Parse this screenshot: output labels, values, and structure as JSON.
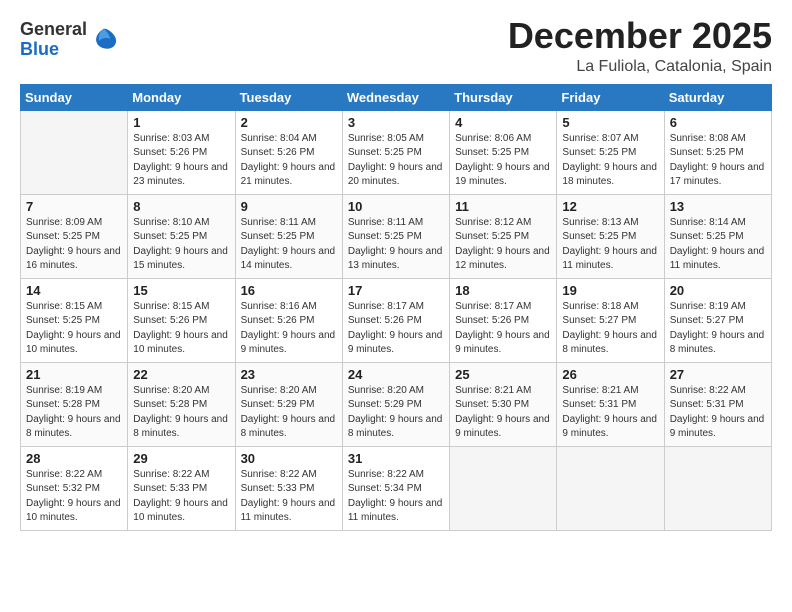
{
  "header": {
    "logo_general": "General",
    "logo_blue": "Blue",
    "month_title": "December 2025",
    "location": "La Fuliola, Catalonia, Spain"
  },
  "weekdays": [
    "Sunday",
    "Monday",
    "Tuesday",
    "Wednesday",
    "Thursday",
    "Friday",
    "Saturday"
  ],
  "weeks": [
    [
      {
        "num": "",
        "empty": true
      },
      {
        "num": "1",
        "sunrise": "8:03 AM",
        "sunset": "5:26 PM",
        "daylight": "9 hours and 23 minutes."
      },
      {
        "num": "2",
        "sunrise": "8:04 AM",
        "sunset": "5:26 PM",
        "daylight": "9 hours and 21 minutes."
      },
      {
        "num": "3",
        "sunrise": "8:05 AM",
        "sunset": "5:25 PM",
        "daylight": "9 hours and 20 minutes."
      },
      {
        "num": "4",
        "sunrise": "8:06 AM",
        "sunset": "5:25 PM",
        "daylight": "9 hours and 19 minutes."
      },
      {
        "num": "5",
        "sunrise": "8:07 AM",
        "sunset": "5:25 PM",
        "daylight": "9 hours and 18 minutes."
      },
      {
        "num": "6",
        "sunrise": "8:08 AM",
        "sunset": "5:25 PM",
        "daylight": "9 hours and 17 minutes."
      }
    ],
    [
      {
        "num": "7",
        "sunrise": "8:09 AM",
        "sunset": "5:25 PM",
        "daylight": "9 hours and 16 minutes."
      },
      {
        "num": "8",
        "sunrise": "8:10 AM",
        "sunset": "5:25 PM",
        "daylight": "9 hours and 15 minutes."
      },
      {
        "num": "9",
        "sunrise": "8:11 AM",
        "sunset": "5:25 PM",
        "daylight": "9 hours and 14 minutes."
      },
      {
        "num": "10",
        "sunrise": "8:11 AM",
        "sunset": "5:25 PM",
        "daylight": "9 hours and 13 minutes."
      },
      {
        "num": "11",
        "sunrise": "8:12 AM",
        "sunset": "5:25 PM",
        "daylight": "9 hours and 12 minutes."
      },
      {
        "num": "12",
        "sunrise": "8:13 AM",
        "sunset": "5:25 PM",
        "daylight": "9 hours and 11 minutes."
      },
      {
        "num": "13",
        "sunrise": "8:14 AM",
        "sunset": "5:25 PM",
        "daylight": "9 hours and 11 minutes."
      }
    ],
    [
      {
        "num": "14",
        "sunrise": "8:15 AM",
        "sunset": "5:25 PM",
        "daylight": "9 hours and 10 minutes."
      },
      {
        "num": "15",
        "sunrise": "8:15 AM",
        "sunset": "5:26 PM",
        "daylight": "9 hours and 10 minutes."
      },
      {
        "num": "16",
        "sunrise": "8:16 AM",
        "sunset": "5:26 PM",
        "daylight": "9 hours and 9 minutes."
      },
      {
        "num": "17",
        "sunrise": "8:17 AM",
        "sunset": "5:26 PM",
        "daylight": "9 hours and 9 minutes."
      },
      {
        "num": "18",
        "sunrise": "8:17 AM",
        "sunset": "5:26 PM",
        "daylight": "9 hours and 9 minutes."
      },
      {
        "num": "19",
        "sunrise": "8:18 AM",
        "sunset": "5:27 PM",
        "daylight": "9 hours and 8 minutes."
      },
      {
        "num": "20",
        "sunrise": "8:19 AM",
        "sunset": "5:27 PM",
        "daylight": "9 hours and 8 minutes."
      }
    ],
    [
      {
        "num": "21",
        "sunrise": "8:19 AM",
        "sunset": "5:28 PM",
        "daylight": "9 hours and 8 minutes."
      },
      {
        "num": "22",
        "sunrise": "8:20 AM",
        "sunset": "5:28 PM",
        "daylight": "9 hours and 8 minutes."
      },
      {
        "num": "23",
        "sunrise": "8:20 AM",
        "sunset": "5:29 PM",
        "daylight": "9 hours and 8 minutes."
      },
      {
        "num": "24",
        "sunrise": "8:20 AM",
        "sunset": "5:29 PM",
        "daylight": "9 hours and 8 minutes."
      },
      {
        "num": "25",
        "sunrise": "8:21 AM",
        "sunset": "5:30 PM",
        "daylight": "9 hours and 9 minutes."
      },
      {
        "num": "26",
        "sunrise": "8:21 AM",
        "sunset": "5:31 PM",
        "daylight": "9 hours and 9 minutes."
      },
      {
        "num": "27",
        "sunrise": "8:22 AM",
        "sunset": "5:31 PM",
        "daylight": "9 hours and 9 minutes."
      }
    ],
    [
      {
        "num": "28",
        "sunrise": "8:22 AM",
        "sunset": "5:32 PM",
        "daylight": "9 hours and 10 minutes."
      },
      {
        "num": "29",
        "sunrise": "8:22 AM",
        "sunset": "5:33 PM",
        "daylight": "9 hours and 10 minutes."
      },
      {
        "num": "30",
        "sunrise": "8:22 AM",
        "sunset": "5:33 PM",
        "daylight": "9 hours and 11 minutes."
      },
      {
        "num": "31",
        "sunrise": "8:22 AM",
        "sunset": "5:34 PM",
        "daylight": "9 hours and 11 minutes."
      },
      {
        "num": "",
        "empty": true
      },
      {
        "num": "",
        "empty": true
      },
      {
        "num": "",
        "empty": true
      }
    ]
  ]
}
